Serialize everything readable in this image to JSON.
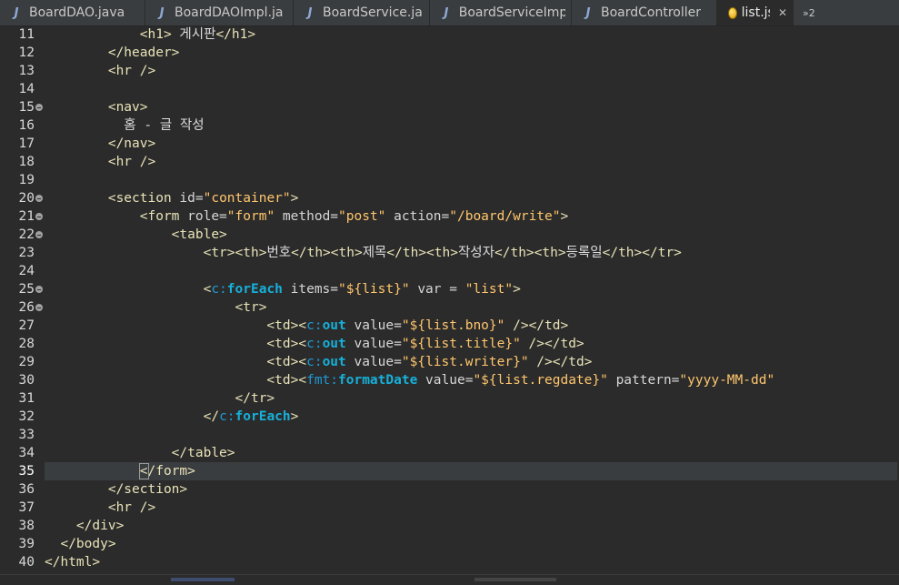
{
  "tabs": [
    {
      "label": "BoardDAO.java",
      "icon": "java-file-icon",
      "glyph": "J",
      "active": false
    },
    {
      "label": "BoardDAOImpl.ja",
      "icon": "java-file-icon",
      "glyph": "J",
      "active": false
    },
    {
      "label": "BoardService.ja",
      "icon": "java-file-icon",
      "glyph": "J",
      "active": false
    },
    {
      "label": "BoardServiceImp",
      "icon": "java-file-icon",
      "glyph": "J",
      "active": false
    },
    {
      "label": "BoardController",
      "icon": "java-file-icon",
      "glyph": "J",
      "active": false
    },
    {
      "label": "list.jsp",
      "icon": "jsp-file-icon",
      "glyph": "",
      "active": true,
      "close": "✕"
    }
  ],
  "overflow": {
    "label": "»2"
  },
  "editor": {
    "current_line": 35,
    "lines": [
      {
        "n": "11",
        "fold": false,
        "tokens": [
          [
            "tag",
            "            <h1>"
          ],
          [
            "txt",
            " 게시판"
          ],
          [
            "tag",
            "</h1>"
          ]
        ]
      },
      {
        "n": "12",
        "fold": false,
        "tokens": [
          [
            "tag",
            "        </header>"
          ]
        ]
      },
      {
        "n": "13",
        "fold": false,
        "tokens": [
          [
            "tag",
            "        <hr />"
          ]
        ]
      },
      {
        "n": "14",
        "fold": false,
        "tokens": []
      },
      {
        "n": "15",
        "fold": true,
        "tokens": [
          [
            "tag",
            "        <nav>"
          ]
        ]
      },
      {
        "n": "16",
        "fold": false,
        "tokens": [
          [
            "txt",
            "          홈 - 글 작성"
          ]
        ]
      },
      {
        "n": "17",
        "fold": false,
        "tokens": [
          [
            "tag",
            "        </nav>"
          ]
        ]
      },
      {
        "n": "18",
        "fold": false,
        "tokens": [
          [
            "tag",
            "        <hr />"
          ]
        ]
      },
      {
        "n": "19",
        "fold": false,
        "tokens": []
      },
      {
        "n": "20",
        "fold": true,
        "tokens": [
          [
            "tag",
            "        <section "
          ],
          [
            "attr",
            "id="
          ],
          [
            "str",
            "\"container\""
          ],
          [
            "tag",
            ">"
          ]
        ]
      },
      {
        "n": "21",
        "fold": true,
        "tokens": [
          [
            "tag",
            "            <form "
          ],
          [
            "attr",
            "role="
          ],
          [
            "str",
            "\"form\""
          ],
          [
            "attr",
            " method="
          ],
          [
            "str",
            "\"post\""
          ],
          [
            "attr",
            " action="
          ],
          [
            "str",
            "\"/board/write\""
          ],
          [
            "tag",
            ">"
          ]
        ]
      },
      {
        "n": "22",
        "fold": true,
        "tokens": [
          [
            "tag",
            "                <table>"
          ]
        ]
      },
      {
        "n": "23",
        "fold": false,
        "tokens": [
          [
            "tag",
            "                    <tr><th>"
          ],
          [
            "txt",
            "번호"
          ],
          [
            "tag",
            "</th><th>"
          ],
          [
            "txt",
            "제목"
          ],
          [
            "tag",
            "</th><th>"
          ],
          [
            "txt",
            "작성자"
          ],
          [
            "tag",
            "</th><th>"
          ],
          [
            "txt",
            "등록일"
          ],
          [
            "tag",
            "</th></tr>"
          ]
        ]
      },
      {
        "n": "24",
        "fold": false,
        "tokens": []
      },
      {
        "n": "25",
        "fold": true,
        "tokens": [
          [
            "tag",
            "                    <"
          ],
          [
            "prefix",
            "c:"
          ],
          [
            "kw",
            "forEach"
          ],
          [
            "attr",
            " items="
          ],
          [
            "str",
            "\"${list}\""
          ],
          [
            "attr",
            " var = "
          ],
          [
            "str",
            "\"list\""
          ],
          [
            "tag",
            ">"
          ]
        ]
      },
      {
        "n": "26",
        "fold": true,
        "tokens": [
          [
            "tag",
            "                        <tr>"
          ]
        ]
      },
      {
        "n": "27",
        "fold": false,
        "tokens": [
          [
            "tag",
            "                            <td><"
          ],
          [
            "prefix",
            "c:"
          ],
          [
            "kw",
            "out"
          ],
          [
            "attr",
            " value="
          ],
          [
            "str",
            "\"${list.bno}\""
          ],
          [
            "tag",
            " /></td>"
          ]
        ]
      },
      {
        "n": "28",
        "fold": false,
        "tokens": [
          [
            "tag",
            "                            <td><"
          ],
          [
            "prefix",
            "c:"
          ],
          [
            "kw",
            "out"
          ],
          [
            "attr",
            " value="
          ],
          [
            "str",
            "\"${list.title}\""
          ],
          [
            "tag",
            " /></td>"
          ]
        ]
      },
      {
        "n": "29",
        "fold": false,
        "tokens": [
          [
            "tag",
            "                            <td><"
          ],
          [
            "prefix",
            "c:"
          ],
          [
            "kw",
            "out"
          ],
          [
            "attr",
            " value="
          ],
          [
            "str",
            "\"${list.writer}\""
          ],
          [
            "tag",
            " /></td>"
          ]
        ]
      },
      {
        "n": "30",
        "fold": false,
        "tokens": [
          [
            "tag",
            "                            <td><"
          ],
          [
            "prefix",
            "fmt:"
          ],
          [
            "kw",
            "formatDate"
          ],
          [
            "attr",
            " value="
          ],
          [
            "str",
            "\"${list.regdate}\""
          ],
          [
            "attr",
            " pattern="
          ],
          [
            "str",
            "\"yyyy-MM-dd\""
          ]
        ]
      },
      {
        "n": "31",
        "fold": false,
        "tokens": [
          [
            "tag",
            "                        </tr>"
          ]
        ]
      },
      {
        "n": "32",
        "fold": false,
        "tokens": [
          [
            "tag",
            "                    </"
          ],
          [
            "prefix",
            "c:"
          ],
          [
            "kw",
            "forEach"
          ],
          [
            "tag",
            ">"
          ]
        ]
      },
      {
        "n": "33",
        "fold": false,
        "tokens": []
      },
      {
        "n": "34",
        "fold": false,
        "tokens": [
          [
            "tag",
            "                </table>"
          ]
        ]
      },
      {
        "n": "35",
        "fold": false,
        "tokens": [
          [
            "tag",
            "            </form>"
          ]
        ]
      },
      {
        "n": "36",
        "fold": false,
        "tokens": [
          [
            "tag",
            "        </section>"
          ]
        ]
      },
      {
        "n": "37",
        "fold": false,
        "tokens": [
          [
            "tag",
            "        <hr />"
          ]
        ]
      },
      {
        "n": "38",
        "fold": false,
        "tokens": [
          [
            "tag",
            "    </div>"
          ]
        ]
      },
      {
        "n": "39",
        "fold": false,
        "tokens": [
          [
            "tag",
            "  </body>"
          ]
        ]
      },
      {
        "n": "40",
        "fold": false,
        "tokens": [
          [
            "tag",
            "</html>"
          ]
        ]
      }
    ]
  },
  "colors": {
    "background": "#2b2b2b",
    "tag": "#e8e2b7",
    "attribute": "#d6d6d6",
    "string": "#ffc66d",
    "jstl_keyword": "#17b0d9",
    "current_line": "#3a3d40"
  }
}
